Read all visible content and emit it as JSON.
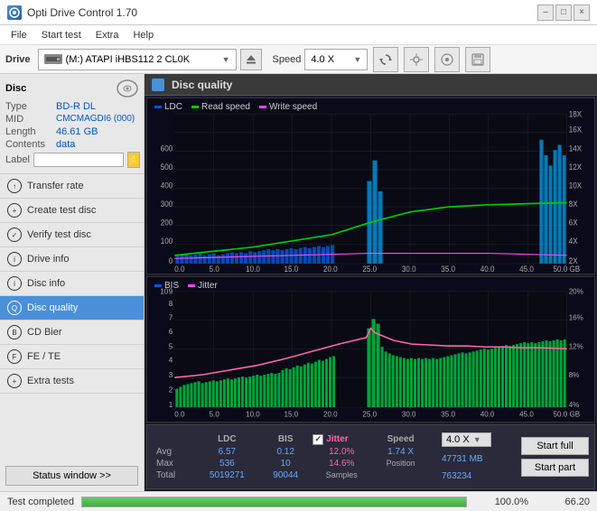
{
  "titleBar": {
    "title": "Opti Drive Control 1.70",
    "minimizeLabel": "–",
    "maximizeLabel": "□",
    "closeLabel": "×"
  },
  "menuBar": {
    "items": [
      "File",
      "Start test",
      "Extra",
      "Help"
    ]
  },
  "driveBar": {
    "driveLabel": "Drive",
    "driveValue": "(M:)  ATAPI iHBS112  2 CL0K",
    "speedLabel": "Speed",
    "speedValue": "4.0 X"
  },
  "disc": {
    "title": "Disc",
    "typeLabel": "Type",
    "typeValue": "BD-R DL",
    "midLabel": "MID",
    "midValue": "CMCMAGDI6 (000)",
    "lengthLabel": "Length",
    "lengthValue": "46.61 GB",
    "contentsLabel": "Contents",
    "contentsValue": "data",
    "labelLabel": "Label",
    "labelValue": ""
  },
  "navItems": [
    {
      "id": "transfer-rate",
      "label": "Transfer rate",
      "active": false
    },
    {
      "id": "create-test-disc",
      "label": "Create test disc",
      "active": false
    },
    {
      "id": "verify-test-disc",
      "label": "Verify test disc",
      "active": false
    },
    {
      "id": "drive-info",
      "label": "Drive info",
      "active": false
    },
    {
      "id": "disc-info",
      "label": "Disc info",
      "active": false
    },
    {
      "id": "disc-quality",
      "label": "Disc quality",
      "active": true
    },
    {
      "id": "cd-bier",
      "label": "CD Bier",
      "active": false
    },
    {
      "id": "fe-te",
      "label": "FE / TE",
      "active": false
    },
    {
      "id": "extra-tests",
      "label": "Extra tests",
      "active": false
    }
  ],
  "statusBtn": "Status window >>",
  "content": {
    "title": "Disc quality",
    "topChart": {
      "legend": [
        "LDC",
        "Read speed",
        "Write speed"
      ],
      "yAxisRight": [
        "18X",
        "16X",
        "14X",
        "12X",
        "10X",
        "8X",
        "6X",
        "4X",
        "2X"
      ],
      "xAxisLabels": [
        "0.0",
        "5.0",
        "10.0",
        "15.0",
        "20.0",
        "25.0",
        "30.0",
        "35.0",
        "40.0",
        "45.0",
        "50.0 GB"
      ]
    },
    "bottomChart": {
      "legend": [
        "BIS",
        "Jitter"
      ],
      "yAxisRight": [
        "20%",
        "16%",
        "12%",
        "8%",
        "4%"
      ],
      "xAxisLabels": [
        "0.0",
        "5.0",
        "10.0",
        "15.0",
        "20.0",
        "25.0",
        "30.0",
        "35.0",
        "40.0",
        "45.0",
        "50.0 GB"
      ]
    },
    "stats": {
      "headers": [
        "",
        "LDC",
        "BIS",
        "",
        "Jitter",
        "Speed"
      ],
      "avgLabel": "Avg",
      "avgLdc": "6.57",
      "avgBis": "0.12",
      "avgJitter": "12.0%",
      "avgSpeed": "1.74 X",
      "maxLabel": "Max",
      "maxLdc": "536",
      "maxBis": "10",
      "maxJitter": "14.6%",
      "maxPosition": "47731 MB",
      "totalLabel": "Total",
      "totalLdc": "5019271",
      "totalBis": "90044",
      "totalSamples": "763234",
      "speedValue": "4.0 X",
      "positionLabel": "Position",
      "samplesLabel": "Samples"
    }
  },
  "actions": {
    "startFull": "Start full",
    "startPart": "Start part"
  },
  "statusBar": {
    "text": "Test completed",
    "progress": 100,
    "progressText": "100.0%",
    "rightValue": "66.20"
  }
}
